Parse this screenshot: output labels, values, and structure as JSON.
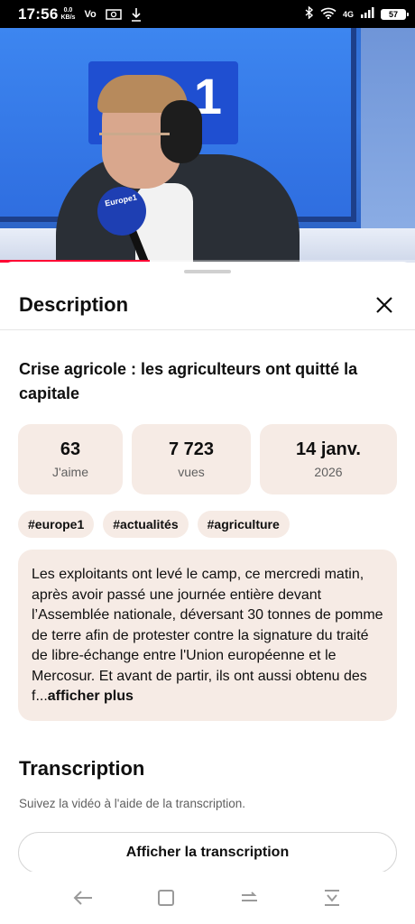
{
  "status_bar": {
    "time": "17:56",
    "speed_value": "0.0",
    "speed_unit": "KB/s",
    "network_label": "Vo",
    "signal_label": "4G",
    "battery": "57"
  },
  "video": {
    "progress": 0.36,
    "logo_text": "1",
    "mic_text": "Europe1"
  },
  "sheet": {
    "title": "Description",
    "video_title": "Crise agricole : les agriculteurs ont quitté la capitale",
    "stats": [
      {
        "value": "63",
        "label": "J'aime"
      },
      {
        "value": "7 723",
        "label": "vues"
      },
      {
        "value": "14 janv.",
        "label": "2026"
      }
    ],
    "tags": [
      "#europe1",
      "#actualités",
      "#agriculture"
    ],
    "description": "Les exploitants ont levé le camp, ce mercredi matin, après avoir passé une journée entière devant l’Assemblée nationale, déversant 30 tonnes de pomme de terre afin de protester contre la signature du traité de libre-échange entre l'Union européenne et le Mercosur. Et avant de partir, ils ont aussi obtenu des f...",
    "show_more": "afficher plus",
    "transcription_title": "Transcription",
    "transcription_subtitle": "Suivez la vidéo à l'aide de la transcription.",
    "transcription_button": "Afficher la transcription"
  },
  "navbar": {
    "items": [
      "back-icon",
      "home-icon",
      "recents-icon",
      "collapse-icon"
    ]
  },
  "colors": {
    "card_bg": "#f6ebe5",
    "progress": "#ff0033"
  }
}
